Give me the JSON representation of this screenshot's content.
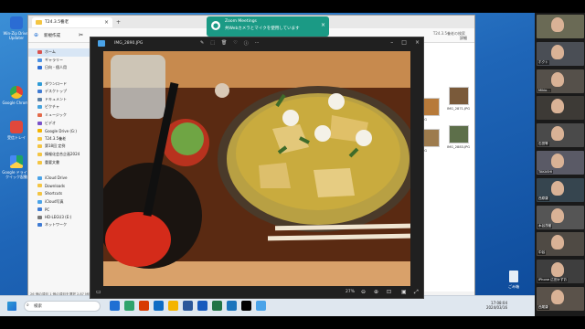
{
  "desktop": {
    "icons": [
      {
        "label": "Win-Zip Driver Updater",
        "color": "#2b6cd3"
      },
      {
        "label": "Google Chrome",
        "color": "#e34133"
      },
      {
        "label": "受信トレイ",
        "color": "#e0483b"
      },
      {
        "label": "Google ドライブ クイック起動",
        "color": "#f5f5f5"
      },
      {
        "label": "",
        "color": "#14a0dc"
      }
    ],
    "recycle_bin": "ごみ箱"
  },
  "explorer": {
    "tab_title": "T24.3.5養老",
    "tab_add": "+",
    "tab_close": "×",
    "toolbar_new": "新規作成",
    "toolbar_details": "詳細",
    "address": "T24.3.5養老の検索",
    "sidebar": [
      {
        "label": "ホーム",
        "color": "#d9534f",
        "selected": true
      },
      {
        "label": "ギャラリー",
        "color": "#4a90e2",
        "selected": false
      },
      {
        "label": "日向 - 個人用",
        "color": "#2b6cd3",
        "selected": false
      },
      {
        "label": "",
        "color": "#ffffff",
        "selected": false
      },
      {
        "label": "ダウンロード",
        "color": "#2f9bd6",
        "selected": false
      },
      {
        "label": "デスクトップ",
        "color": "#3f7bd3",
        "selected": false
      },
      {
        "label": "ドキュメント",
        "color": "#5b7fa3",
        "selected": false
      },
      {
        "label": "ピクチャ",
        "color": "#46a3dd",
        "selected": false
      },
      {
        "label": "ミュージック",
        "color": "#e36a4a",
        "selected": false
      },
      {
        "label": "ビデオ",
        "color": "#7a52c8",
        "selected": false
      },
      {
        "label": "Google Drive (G:)",
        "color": "#f4b400",
        "selected": false
      },
      {
        "label": "T24.3.5養老",
        "color": "#f4c542",
        "selected": false
      },
      {
        "label": "第18回 定例",
        "color": "#f4c542",
        "selected": false
      },
      {
        "label": "情報化会合企画2024",
        "color": "#f4c542",
        "selected": false
      },
      {
        "label": "重要文書",
        "color": "#f4c542",
        "selected": false
      },
      {
        "label": "",
        "color": "#ffffff",
        "selected": false
      },
      {
        "label": "iCloud Drive",
        "color": "#4aa3e8",
        "selected": false
      },
      {
        "label": "Downloads",
        "color": "#f4c542",
        "selected": false
      },
      {
        "label": "Shortcuts",
        "color": "#f4c542",
        "selected": false
      },
      {
        "label": "iCloud写真",
        "color": "#4aa3e8",
        "selected": false
      },
      {
        "label": "PC",
        "color": "#3f7bd3",
        "selected": false
      },
      {
        "label": "HD-LEGU3 (E:)",
        "color": "#777777",
        "selected": false
      },
      {
        "label": "ネットワーク",
        "color": "#3f7bd3",
        "selected": false
      }
    ],
    "status": "26 個の項目   1 個の項目を選択 2.87 MB",
    "thumbs": [
      {
        "label": "JPG",
        "color": "#b77a3a"
      },
      {
        "label": "IMG_2871.JPG",
        "color": "#7a5a3a"
      },
      {
        "label": "JPG",
        "color": "#9d7b4d"
      },
      {
        "label": "IMG_2883.JPG",
        "color": "#5d6f4a"
      }
    ]
  },
  "viewer": {
    "filename": "IMG_2890.JPG",
    "zoom": "27%",
    "tool_icons": [
      "✎",
      "⬚",
      "🗑",
      "♡",
      "ⓘ",
      "⋯"
    ]
  },
  "notification": {
    "title": "Zoom Meetings",
    "body": "共Webカメラとマイクを使用しています",
    "close": "×"
  },
  "participants": [
    {
      "name": "",
      "bg": "#6a6a55"
    },
    {
      "name": "ホクト",
      "bg": "#4a4e55"
    },
    {
      "name": "Mikio...",
      "bg": "#55504a"
    },
    {
      "name": "",
      "bg": "#3d3a36"
    },
    {
      "name": "石田等",
      "bg": "#4a4a4a"
    },
    {
      "name": "TAKASHI",
      "bg": "#5a5a66"
    },
    {
      "name": "西原康",
      "bg": "#36454f"
    },
    {
      "name": "木谷茂樹",
      "bg": "#555555"
    },
    {
      "name": "中谷",
      "bg": "#4f4a44"
    },
    {
      "name": "iPhone 広田かずお",
      "bg": "#3e3e3e"
    },
    {
      "name": "西尾康",
      "bg": "#5a524a"
    }
  ],
  "taskbar": {
    "search": "検索",
    "time": "17:08:04",
    "date": "2024/03/16",
    "apps": [
      "#1f6fd3",
      "#2fa36b",
      "#d83b01",
      "#0e6cc4",
      "#f4b400",
      "#2b579a",
      "#185abd",
      "#217346",
      "#1c75bc",
      "#000000",
      "#4aa3e8"
    ]
  }
}
